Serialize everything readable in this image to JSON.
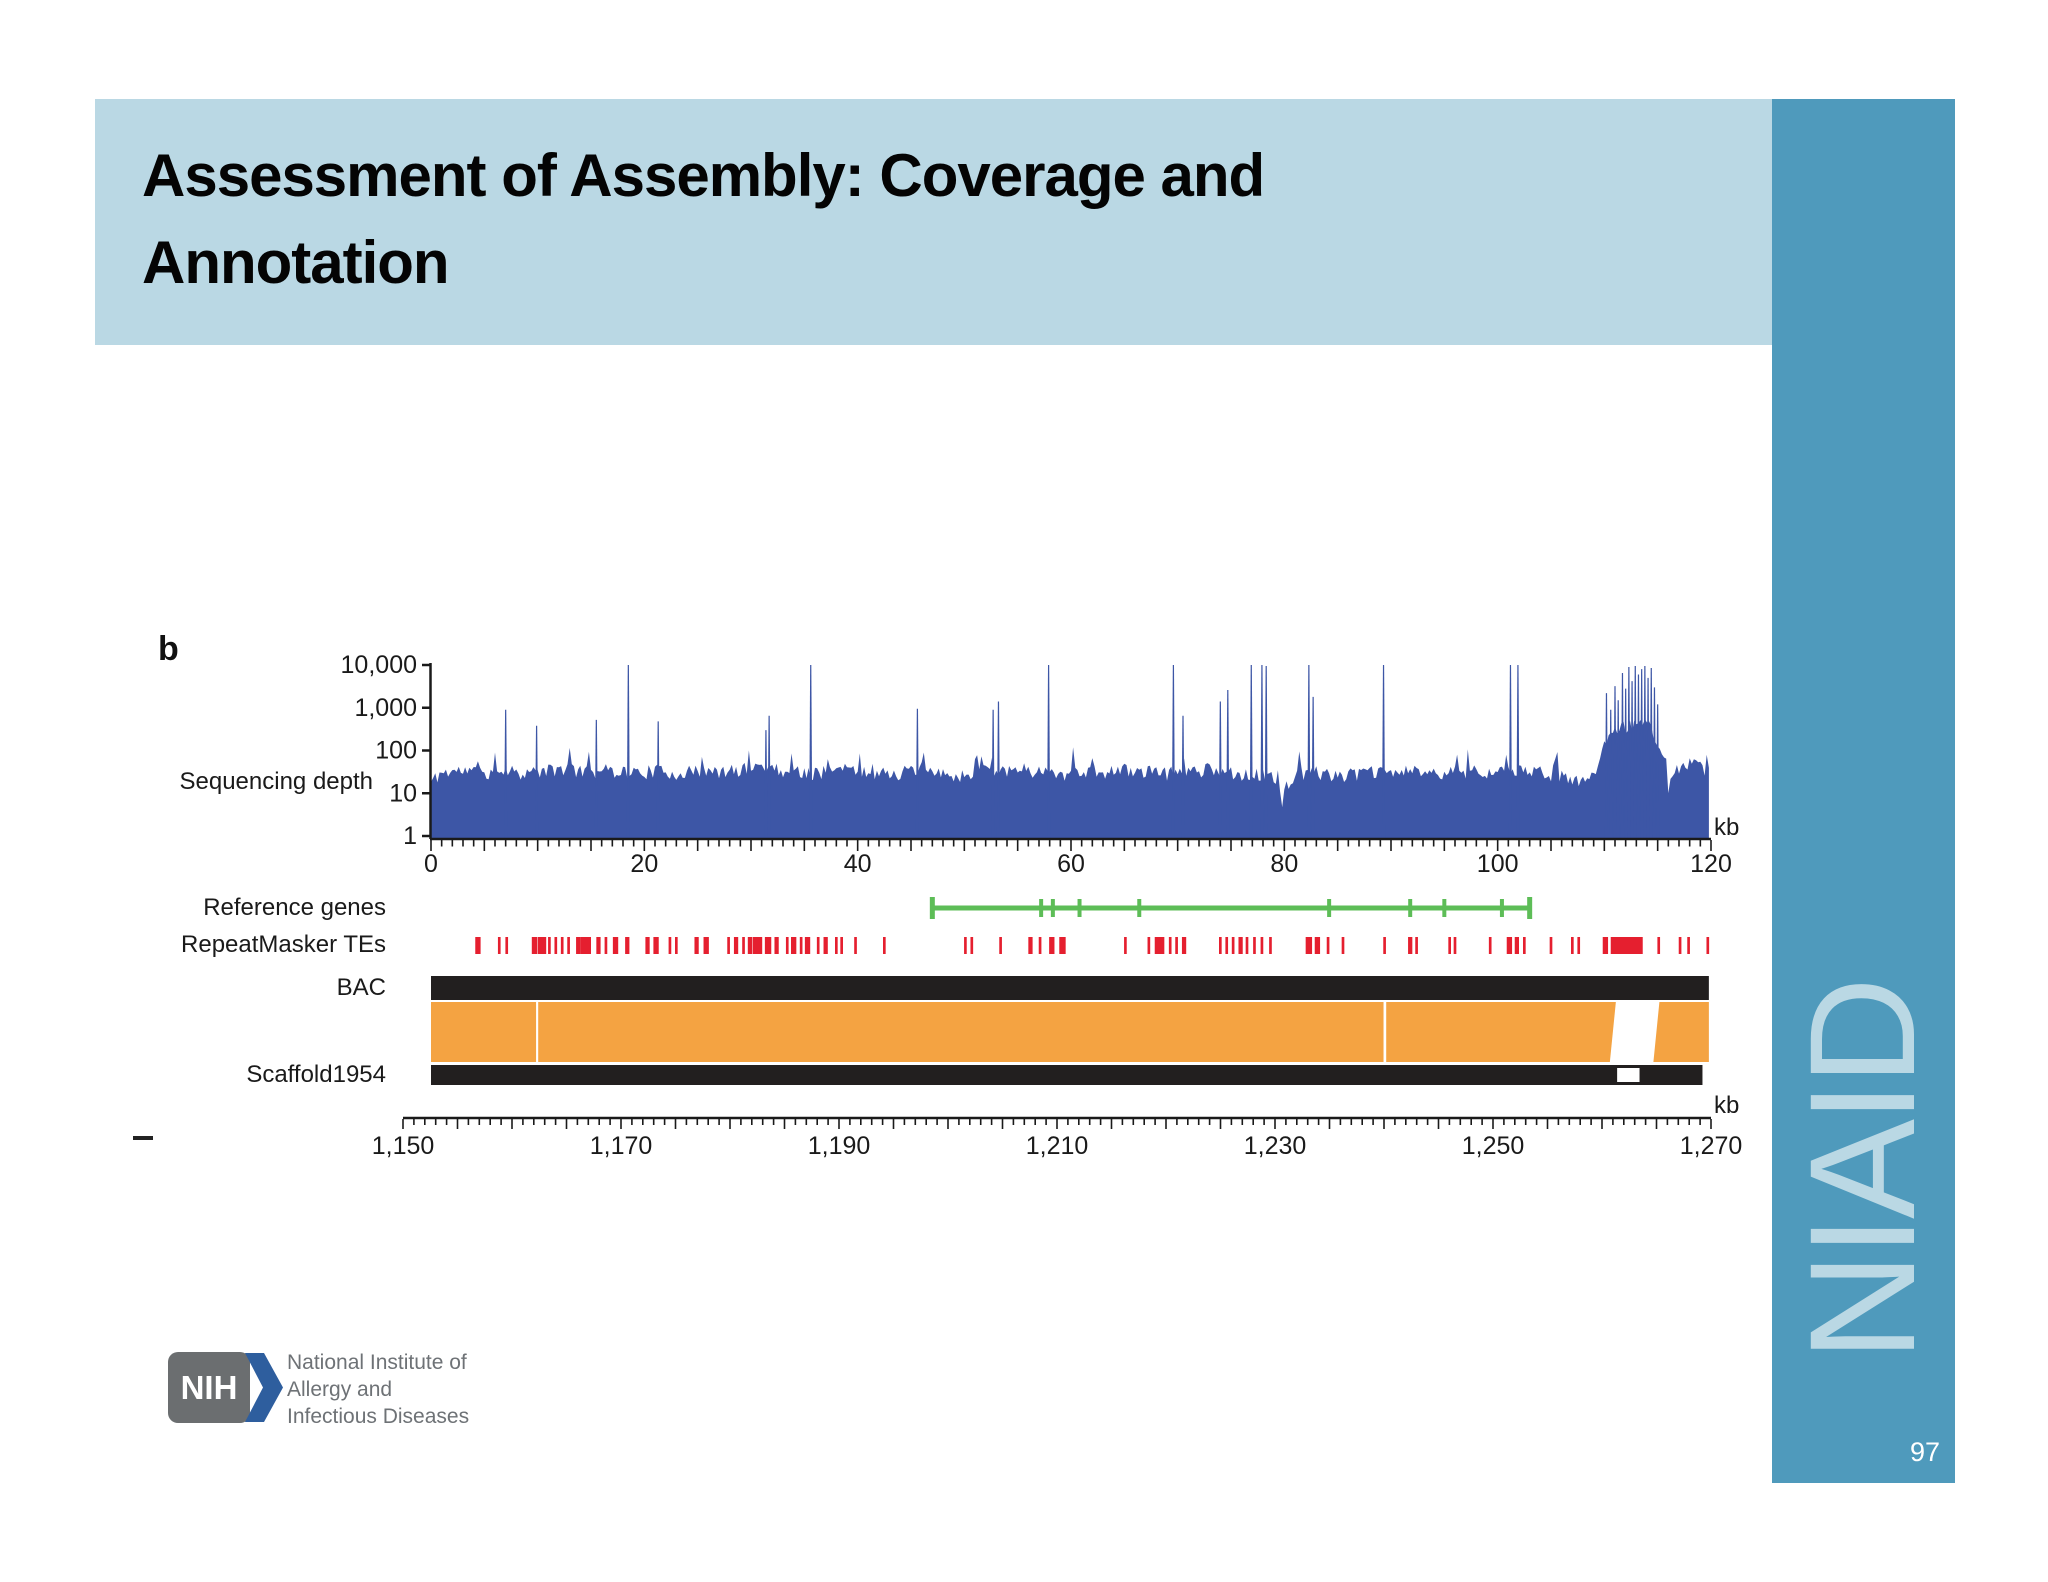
{
  "slide": {
    "title_line1": "Assessment of Assembly: Coverage and",
    "title_line2": "Annotation",
    "sidebar_text": "NIAID",
    "page_number": "97",
    "colors": {
      "title_band": "#bad8e4",
      "sidebar": "#4f9abc",
      "sidebar_text": "#bad8e4"
    }
  },
  "figure": {
    "panel_label": "b",
    "y_axis_label": "Sequencing depth",
    "top_axis_unit": "kb",
    "bottom_axis_unit": "kb",
    "track_labels": {
      "reference_genes": "Reference genes",
      "repeatmasker": "RepeatMasker TEs",
      "bac": "BAC",
      "scaffold": "Scaffold1954"
    }
  },
  "logo": {
    "nih": "NIH",
    "line1": "National Institute of",
    "line2": "Allergy and",
    "line3": "Infectious Diseases"
  },
  "chart_data": {
    "type": "area",
    "title": "Sequencing depth across BAC region with annotation tracks",
    "y_axis": {
      "scale": "log",
      "range": [
        1,
        10000
      ],
      "ticks": [
        10000,
        1000,
        100,
        10,
        1
      ],
      "tick_labels": [
        "10,000",
        "1,000",
        "100",
        "10",
        "1"
      ],
      "label": "Sequencing depth"
    },
    "top_axis": {
      "range_kb": [
        0,
        120
      ],
      "ticks": [
        0,
        20,
        40,
        60,
        80,
        100,
        120
      ],
      "tick_labels": [
        "0",
        "20",
        "40",
        "60",
        "80",
        "100",
        "120"
      ],
      "minor_tick_every_kb": 1,
      "unit": "kb"
    },
    "bottom_axis": {
      "range_kb": [
        1150,
        1270
      ],
      "ticks": [
        1150,
        1170,
        1190,
        1210,
        1230,
        1250,
        1270
      ],
      "tick_labels": [
        "1,150",
        "1,170",
        "1,190",
        "1,210",
        "1,230",
        "1,250",
        "1,270"
      ],
      "minor_tick_every_kb": 1,
      "unit": "kb"
    },
    "colors": {
      "coverage": "#3d56a6",
      "reference_genes": "#5dbd57",
      "repeat_tes": "#e51f2f",
      "black_track": "#221f1f",
      "alignment": "#f4a342"
    },
    "coverage": {
      "end_kb": 119.8,
      "sample_step_kb": 0.2,
      "noise_seed": 11,
      "noise_amp": 0.75,
      "baseline": [
        [
          0,
          18
        ],
        [
          1,
          30
        ],
        [
          3,
          34
        ],
        [
          5,
          30
        ],
        [
          7,
          36
        ],
        [
          9,
          30
        ],
        [
          11,
          34
        ],
        [
          13,
          38
        ],
        [
          15,
          32
        ],
        [
          17,
          36
        ],
        [
          19,
          30
        ],
        [
          21,
          34
        ],
        [
          23,
          29
        ],
        [
          25,
          33
        ],
        [
          27,
          30
        ],
        [
          29,
          36
        ],
        [
          31,
          44
        ],
        [
          32,
          40
        ],
        [
          33,
          34
        ],
        [
          35,
          30
        ],
        [
          37,
          33
        ],
        [
          39,
          36
        ],
        [
          41,
          31
        ],
        [
          43,
          29
        ],
        [
          45,
          33
        ],
        [
          47,
          29
        ],
        [
          49,
          25
        ],
        [
          51,
          30
        ],
        [
          53,
          35
        ],
        [
          55,
          38
        ],
        [
          57,
          33
        ],
        [
          59,
          29
        ],
        [
          61,
          33
        ],
        [
          63,
          30
        ],
        [
          65,
          36
        ],
        [
          67,
          32
        ],
        [
          69,
          30
        ],
        [
          71,
          34
        ],
        [
          73,
          37
        ],
        [
          75,
          31
        ],
        [
          77,
          29
        ],
        [
          79,
          22
        ],
        [
          79.8,
          7
        ],
        [
          80.5,
          20
        ],
        [
          82,
          33
        ],
        [
          84,
          29
        ],
        [
          86,
          27
        ],
        [
          88,
          31
        ],
        [
          90,
          30
        ],
        [
          92,
          34
        ],
        [
          94,
          29
        ],
        [
          96,
          31
        ],
        [
          98,
          36
        ],
        [
          100,
          30
        ],
        [
          102,
          34
        ],
        [
          104,
          31
        ],
        [
          106,
          26
        ],
        [
          107.5,
          18
        ],
        [
          108.5,
          25
        ],
        [
          109.5,
          45
        ],
        [
          110,
          120
        ],
        [
          110.5,
          260
        ],
        [
          111,
          340
        ],
        [
          111.5,
          420
        ],
        [
          112,
          380
        ],
        [
          112.5,
          430
        ],
        [
          113,
          390
        ],
        [
          113.5,
          440
        ],
        [
          114,
          400
        ],
        [
          114.5,
          300
        ],
        [
          115,
          160
        ],
        [
          115.5,
          60
        ],
        [
          116,
          12
        ],
        [
          116.5,
          25
        ],
        [
          117,
          42
        ],
        [
          118,
          48
        ],
        [
          119,
          42
        ],
        [
          119.8,
          30
        ]
      ],
      "spikes": [
        [
          7.0,
          900
        ],
        [
          9.9,
          380
        ],
        [
          15.5,
          520
        ],
        [
          18.5,
          10000
        ],
        [
          21.3,
          480
        ],
        [
          31.4,
          300
        ],
        [
          31.7,
          650
        ],
        [
          35.6,
          10000
        ],
        [
          45.6,
          950
        ],
        [
          52.7,
          900
        ],
        [
          53.2,
          1400
        ],
        [
          57.9,
          10000
        ],
        [
          69.6,
          10000
        ],
        [
          70.5,
          650
        ],
        [
          74.0,
          1400
        ],
        [
          74.7,
          2600
        ],
        [
          76.9,
          10000
        ],
        [
          77.9,
          10000
        ],
        [
          78.3,
          9500
        ],
        [
          82.3,
          10000
        ],
        [
          82.7,
          1800
        ],
        [
          89.3,
          10000
        ],
        [
          101.2,
          10000
        ],
        [
          101.9,
          10000
        ],
        [
          110.2,
          2200
        ],
        [
          110.6,
          900
        ],
        [
          111.0,
          3200
        ],
        [
          111.3,
          1500
        ],
        [
          111.7,
          6500
        ],
        [
          112.0,
          2800
        ],
        [
          112.3,
          9000
        ],
        [
          112.6,
          4200
        ],
        [
          112.9,
          9500
        ],
        [
          113.2,
          6000
        ],
        [
          113.5,
          8000
        ],
        [
          113.8,
          9500
        ],
        [
          114.1,
          5000
        ],
        [
          114.4,
          8500
        ],
        [
          114.7,
          3000
        ],
        [
          115.0,
          1200
        ]
      ]
    },
    "reference_genes": {
      "start_kb": 47.0,
      "end_kb": 103.0,
      "exon_ticks_kb": [
        57.2,
        58.3,
        60.8,
        66.4,
        84.2,
        91.8,
        95.0,
        100.4
      ]
    },
    "repeat_tes_marks_kb": [
      [
        4.4,
        0.5
      ],
      [
        6.4,
        0.25
      ],
      [
        7.1,
        0.25
      ],
      [
        9.7,
        0.5
      ],
      [
        10.4,
        0.8
      ],
      [
        11.1,
        0.25
      ],
      [
        11.7,
        0.25
      ],
      [
        12.3,
        0.25
      ],
      [
        12.9,
        0.25
      ],
      [
        13.8,
        0.4
      ],
      [
        14.5,
        1.0
      ],
      [
        15.7,
        0.4
      ],
      [
        16.4,
        0.25
      ],
      [
        17.3,
        0.5
      ],
      [
        18.4,
        0.4
      ],
      [
        20.3,
        0.4
      ],
      [
        21.1,
        0.5
      ],
      [
        22.4,
        0.25
      ],
      [
        23.0,
        0.25
      ],
      [
        24.9,
        0.4
      ],
      [
        25.8,
        0.5
      ],
      [
        27.9,
        0.25
      ],
      [
        28.6,
        0.4
      ],
      [
        29.3,
        0.25
      ],
      [
        29.9,
        0.4
      ],
      [
        30.6,
        0.9
      ],
      [
        31.6,
        0.6
      ],
      [
        32.4,
        0.4
      ],
      [
        33.4,
        0.25
      ],
      [
        34.0,
        0.5
      ],
      [
        34.7,
        0.25
      ],
      [
        35.3,
        0.5
      ],
      [
        36.3,
        0.25
      ],
      [
        37.0,
        0.4
      ],
      [
        38.0,
        0.25
      ],
      [
        38.5,
        0.25
      ],
      [
        39.8,
        0.25
      ],
      [
        42.5,
        0.25
      ],
      [
        50.1,
        0.25
      ],
      [
        50.7,
        0.25
      ],
      [
        53.4,
        0.25
      ],
      [
        56.2,
        0.4
      ],
      [
        57.1,
        0.25
      ],
      [
        58.2,
        0.5
      ],
      [
        59.2,
        0.6
      ],
      [
        65.1,
        0.25
      ],
      [
        67.3,
        0.25
      ],
      [
        68.3,
        0.9
      ],
      [
        69.3,
        0.25
      ],
      [
        69.9,
        0.25
      ],
      [
        70.6,
        0.4
      ],
      [
        74.0,
        0.25
      ],
      [
        74.6,
        0.25
      ],
      [
        75.2,
        0.25
      ],
      [
        75.9,
        0.4
      ],
      [
        76.5,
        0.25
      ],
      [
        77.2,
        0.25
      ],
      [
        77.9,
        0.25
      ],
      [
        78.7,
        0.25
      ],
      [
        82.3,
        0.6
      ],
      [
        83.1,
        0.5
      ],
      [
        84.1,
        0.25
      ],
      [
        85.5,
        0.25
      ],
      [
        89.4,
        0.25
      ],
      [
        91.8,
        0.4
      ],
      [
        92.4,
        0.25
      ],
      [
        95.5,
        0.25
      ],
      [
        96.0,
        0.25
      ],
      [
        99.3,
        0.25
      ],
      [
        101.1,
        0.5
      ],
      [
        101.8,
        0.4
      ],
      [
        102.5,
        0.25
      ],
      [
        105.0,
        0.25
      ],
      [
        107.0,
        0.25
      ],
      [
        107.6,
        0.25
      ],
      [
        110.1,
        0.5
      ],
      [
        110.8,
        0.4
      ],
      [
        111.6,
        0.5
      ],
      [
        112.3,
        2.6
      ],
      [
        115.1,
        0.25
      ],
      [
        117.1,
        0.25
      ],
      [
        117.9,
        0.25
      ],
      [
        119.7,
        0.25
      ]
    ],
    "bac_track": {
      "start_kb": 0,
      "end_kb": 119.8
    },
    "alignment_blocks_kb": [
      [
        0,
        9.85
      ],
      [
        10.05,
        89.3
      ],
      [
        89.55,
        110.8
      ],
      [
        114.6,
        119.8
      ]
    ],
    "alignment_gap_slanted": true,
    "scaffold_track": {
      "start_kb": 0,
      "end_kb": 119.2,
      "gap_kb": [
        111.2,
        113.3
      ]
    }
  }
}
